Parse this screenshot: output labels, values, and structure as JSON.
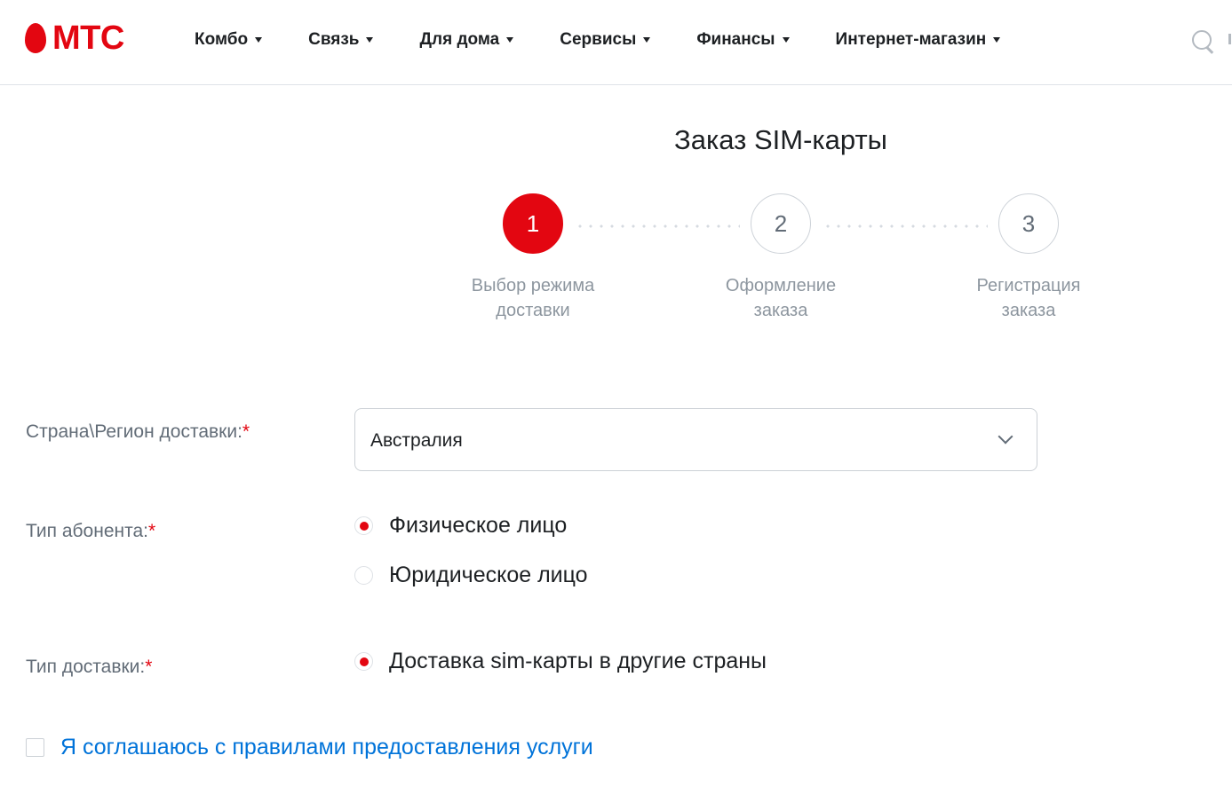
{
  "header": {
    "logo_text": "МТС",
    "nav": [
      "Комбо",
      "Связь",
      "Для дома",
      "Сервисы",
      "Финансы",
      "Интернет-магазин"
    ],
    "icons": {
      "logo": "mts-egg-icon",
      "search": "search-icon"
    }
  },
  "page": {
    "title": "Заказ SIM-карты"
  },
  "stepper": {
    "current_step": 1,
    "steps": [
      {
        "number": "1",
        "label_line1": "Выбор режима",
        "label_line2": "доставки"
      },
      {
        "number": "2",
        "label_line1": "Оформление",
        "label_line2": "заказа"
      },
      {
        "number": "3",
        "label_line1": "Регистрация",
        "label_line2": "заказа"
      }
    ]
  },
  "form": {
    "country": {
      "label": "Страна\\Регион доставки:",
      "required_mark": "*",
      "value": "Австралия"
    },
    "subscriber_type": {
      "label": "Тип абонента:",
      "required_mark": "*",
      "options": [
        "Физическое лицо",
        "Юридическое лицо"
      ],
      "selected_index": 0
    },
    "delivery_type": {
      "label": "Тип доставки:",
      "required_mark": "*",
      "options": [
        "Доставка sim-карты в другие страны"
      ],
      "selected_index": 0
    },
    "agreement": {
      "text": "Я соглашаюсь с правилами предоставления услуги",
      "checked": false
    }
  },
  "colors": {
    "brand_red": "#e30611",
    "link_blue": "#0073d9",
    "muted_text": "#626c77",
    "step_label": "#8d969f"
  }
}
